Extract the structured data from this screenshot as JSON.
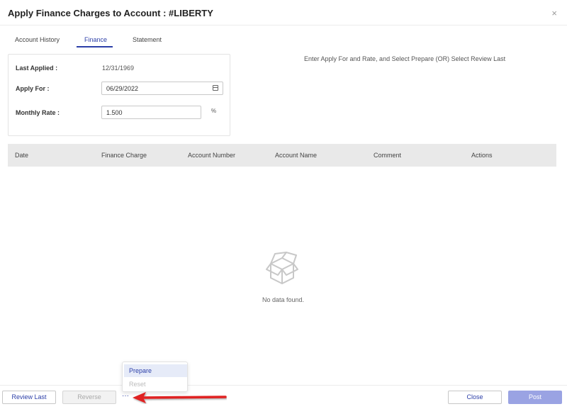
{
  "dialog": {
    "title": "Apply Finance Charges to Account : #LIBERTY",
    "close_glyph": "×"
  },
  "tabs": [
    {
      "label": "Account History",
      "active": false
    },
    {
      "label": "Finance",
      "active": true
    },
    {
      "label": "Statement",
      "active": false
    }
  ],
  "form": {
    "last_applied_label": "Last Applied :",
    "last_applied_value": "12/31/1969",
    "apply_for_label": "Apply For :",
    "apply_for_value": "06/29/2022",
    "monthly_rate_label": "Monthly Rate :",
    "monthly_rate_value": "1.500",
    "rate_unit": "%"
  },
  "instruction": "Enter Apply For and Rate, and Select Prepare (OR) Select Review Last",
  "table": {
    "columns": [
      "Date",
      "Finance Charge",
      "Account Number",
      "Account Name",
      "Comment",
      "Actions"
    ],
    "rows": [],
    "empty_text": "No data found."
  },
  "footer": {
    "review_last": "Review Last",
    "reverse": "Reverse",
    "more": "···",
    "close": "Close",
    "post": "Post"
  },
  "more_menu": {
    "items": [
      {
        "label": "Prepare",
        "enabled": true
      },
      {
        "label": "Reset",
        "enabled": false
      }
    ]
  },
  "icons": {
    "empty": "empty-box-icon",
    "calendar": "calendar-icon",
    "annotation": "red-arrow-annotation"
  },
  "colors": {
    "accent": "#2c3fa8",
    "post_button": "#9aa3e3",
    "arrow": "#e02020",
    "header_bg": "#e9e9e9"
  }
}
